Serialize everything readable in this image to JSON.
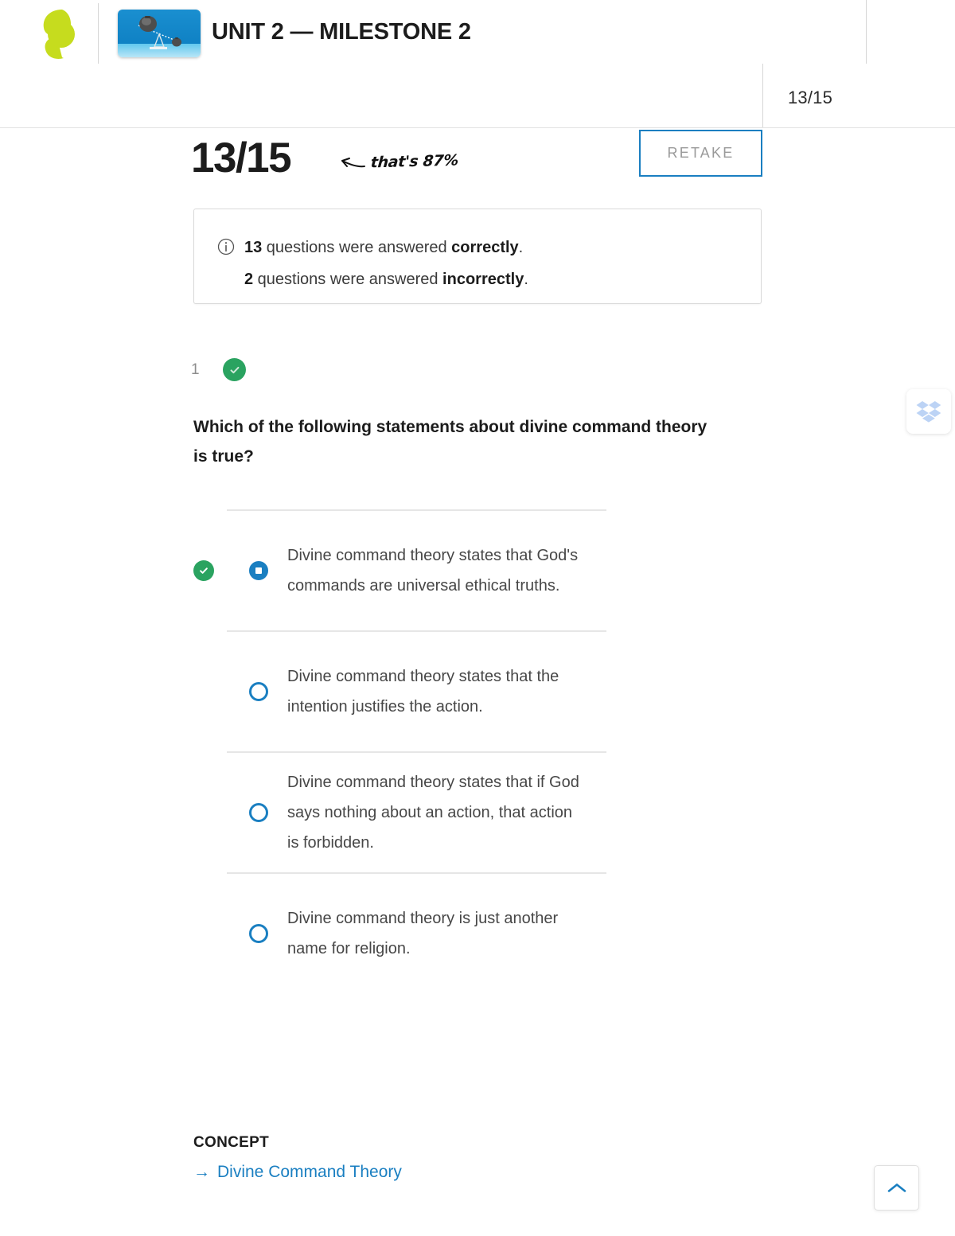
{
  "header": {
    "logo_name": "sophia-logo",
    "thumbnail_name": "balance-scale-thumbnail",
    "title": "UNIT 2 — MILESTONE 2",
    "score_mini": "13/15"
  },
  "score_row": {
    "score": "13/15",
    "annotation_text": "that's 87%",
    "annotation_arrow_name": "left-arrow-annotation",
    "retake_label": "RETAKE"
  },
  "info_box": {
    "icon_name": "info-icon",
    "correct_count": "13",
    "correct_prefix": " questions were answered ",
    "correct_word": "correctly",
    "correct_suffix": ".",
    "incorrect_count": "2",
    "incorrect_prefix": " questions were answered ",
    "incorrect_word": "incorrectly",
    "incorrect_suffix": "."
  },
  "question": {
    "number": "1",
    "status": "correct",
    "text": "Which of the following statements about divine command theory is true?",
    "options": [
      {
        "text": "Divine command theory states that God's commands are universal ethical truths.",
        "selected": true,
        "correct": true
      },
      {
        "text": "Divine command theory states that the intention justifies the action.",
        "selected": false,
        "correct": false
      },
      {
        "text": "Divine command theory states that if God says nothing about an action, that action is forbidden.",
        "selected": false,
        "correct": false
      },
      {
        "text": "Divine command theory is just another name for religion.",
        "selected": false,
        "correct": false
      }
    ]
  },
  "concept": {
    "label": "CONCEPT",
    "link_text": "Divine Command Theory",
    "arrow": "→"
  },
  "widgets": {
    "dropbox_name": "dropbox-save-icon",
    "scroll_top_name": "scroll-to-top-button"
  },
  "colors": {
    "accent_blue": "#1a7fc1",
    "correct_green": "#2aa360",
    "logo_green": "#c6dc1e",
    "thumb_blue": "#1186c8"
  }
}
